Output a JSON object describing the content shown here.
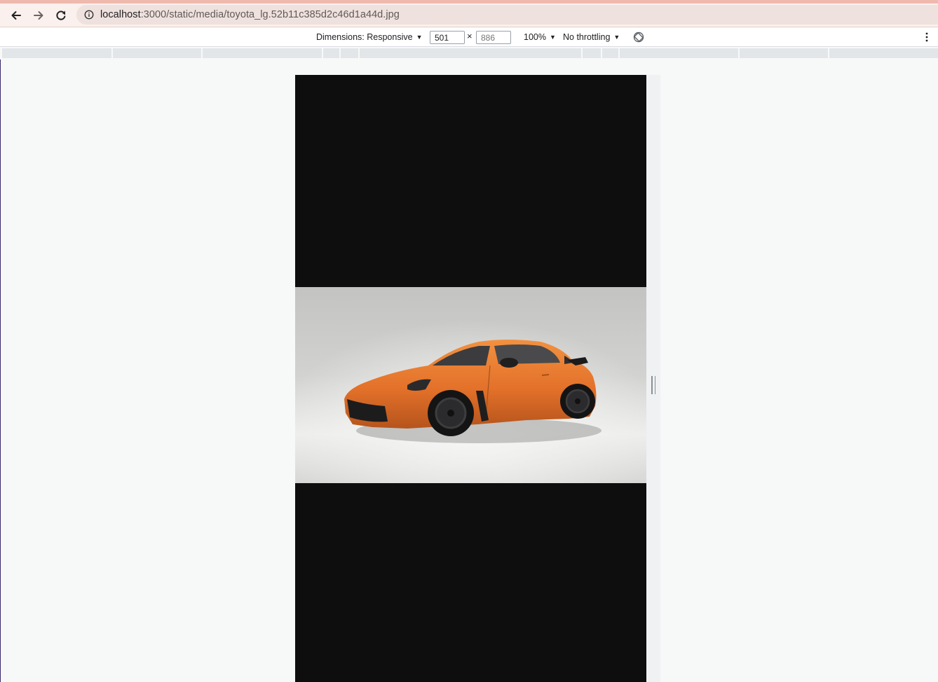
{
  "browser": {
    "url_host": "localhost",
    "url_path": ":3000/static/media/toyota_lg.52b11c385d2c46d1a44d.jpg",
    "icons": {
      "back": "arrow-left-icon",
      "forward": "arrow-right-icon",
      "reload": "reload-icon",
      "info": "info-circle-icon"
    }
  },
  "device_toolbar": {
    "dimensions_label": "Dimensions: Responsive",
    "width_value": "501",
    "height_placeholder": "886",
    "times_symbol": "×",
    "zoom_label": "100%",
    "throttling_label": "No throttling",
    "icons": {
      "rotate": "rotate-icon",
      "more": "more-vertical-icon"
    }
  },
  "media_query_bar": {
    "segment_count": 12
  },
  "viewport": {
    "image_subject": "orange sports coupe on grey studio backdrop",
    "background_color": "#0e0e0e",
    "car_color": "#e8782a"
  },
  "colors": {
    "accent_strip": "#efb9ad",
    "toolbar_bg": "#faf0ed",
    "omnibox_bg": "#efe1dd"
  }
}
